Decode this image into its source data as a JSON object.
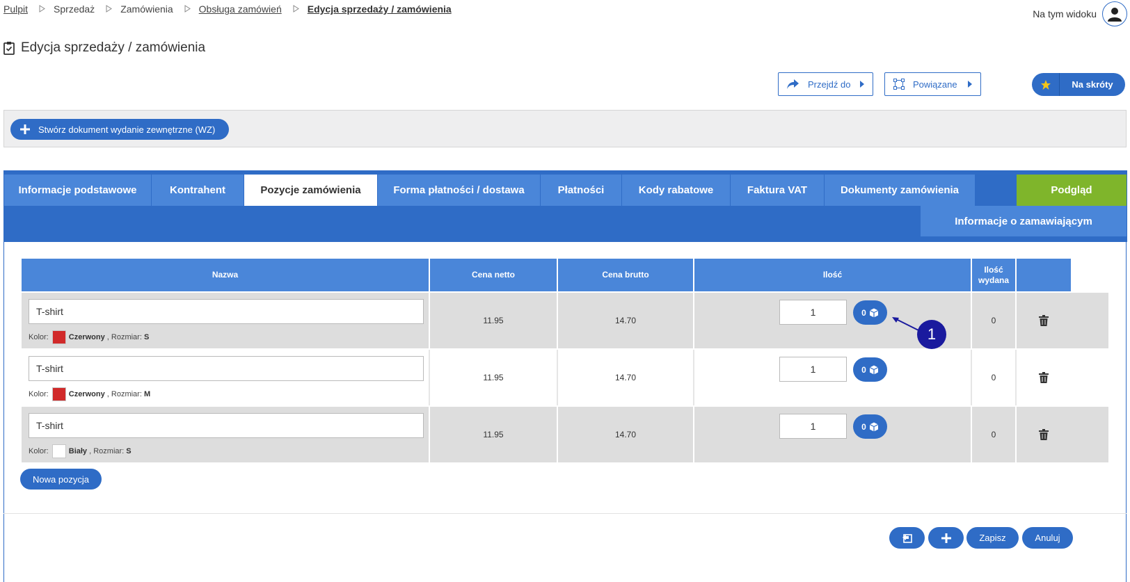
{
  "breadcrumb": [
    "Pulpit",
    "Sprzedaż",
    "Zamówienia",
    "Obsługa zamówień",
    "Edycja sprzedaży / zamówienia"
  ],
  "view_label": "Na tym widoku",
  "page_title": "Edycja sprzedaży / zamówienia",
  "actions": {
    "goto": "Przejdź do",
    "related": "Powiązane",
    "shortcuts": "Na skróty"
  },
  "toolbar": {
    "create_wz": "Stwórz dokument wydanie zewnętrzne (WZ)"
  },
  "tabs": [
    "Informacje podstawowe",
    "Kontrahent",
    "Pozycje zamówienia",
    "Forma płatności / dostawa",
    "Płatności",
    "Kody rabatowe",
    "Faktura VAT",
    "Dokumenty zamówienia",
    "Podgląd",
    "Informacje o zamawiającym"
  ],
  "active_tab": "Pozycje zamówienia",
  "table": {
    "headers": {
      "name": "Nazwa",
      "net": "Cena netto",
      "gross": "Cena brutto",
      "qty": "Ilość",
      "issued_1": "Ilość",
      "issued_2": "wydana"
    },
    "color_label": "Kolor:",
    "size_label": ", Rozmiar:",
    "rows": [
      {
        "name": "T-shirt",
        "color": "Czerwony",
        "color_hex": "#d12a2a",
        "size": "S",
        "net": "11.95",
        "gross": "14.70",
        "qty": "1",
        "packages": "0",
        "issued": "0"
      },
      {
        "name": "T-shirt",
        "color": "Czerwony",
        "color_hex": "#d12a2a",
        "size": "M",
        "net": "11.95",
        "gross": "14.70",
        "qty": "1",
        "packages": "0",
        "issued": "0"
      },
      {
        "name": "T-shirt",
        "color": "Biały",
        "color_hex": "#ffffff",
        "size": "S",
        "net": "11.95",
        "gross": "14.70",
        "qty": "1",
        "packages": "0",
        "issued": "0"
      }
    ]
  },
  "new_position": "Nowa pozycja",
  "footer": {
    "save": "Zapisz",
    "cancel": "Anuluj"
  },
  "callout_number": "1",
  "colors": {
    "primary": "#2f6cc6",
    "tab": "#4a86d9",
    "preview": "#7fb52b",
    "callout": "#1a1a9e"
  }
}
